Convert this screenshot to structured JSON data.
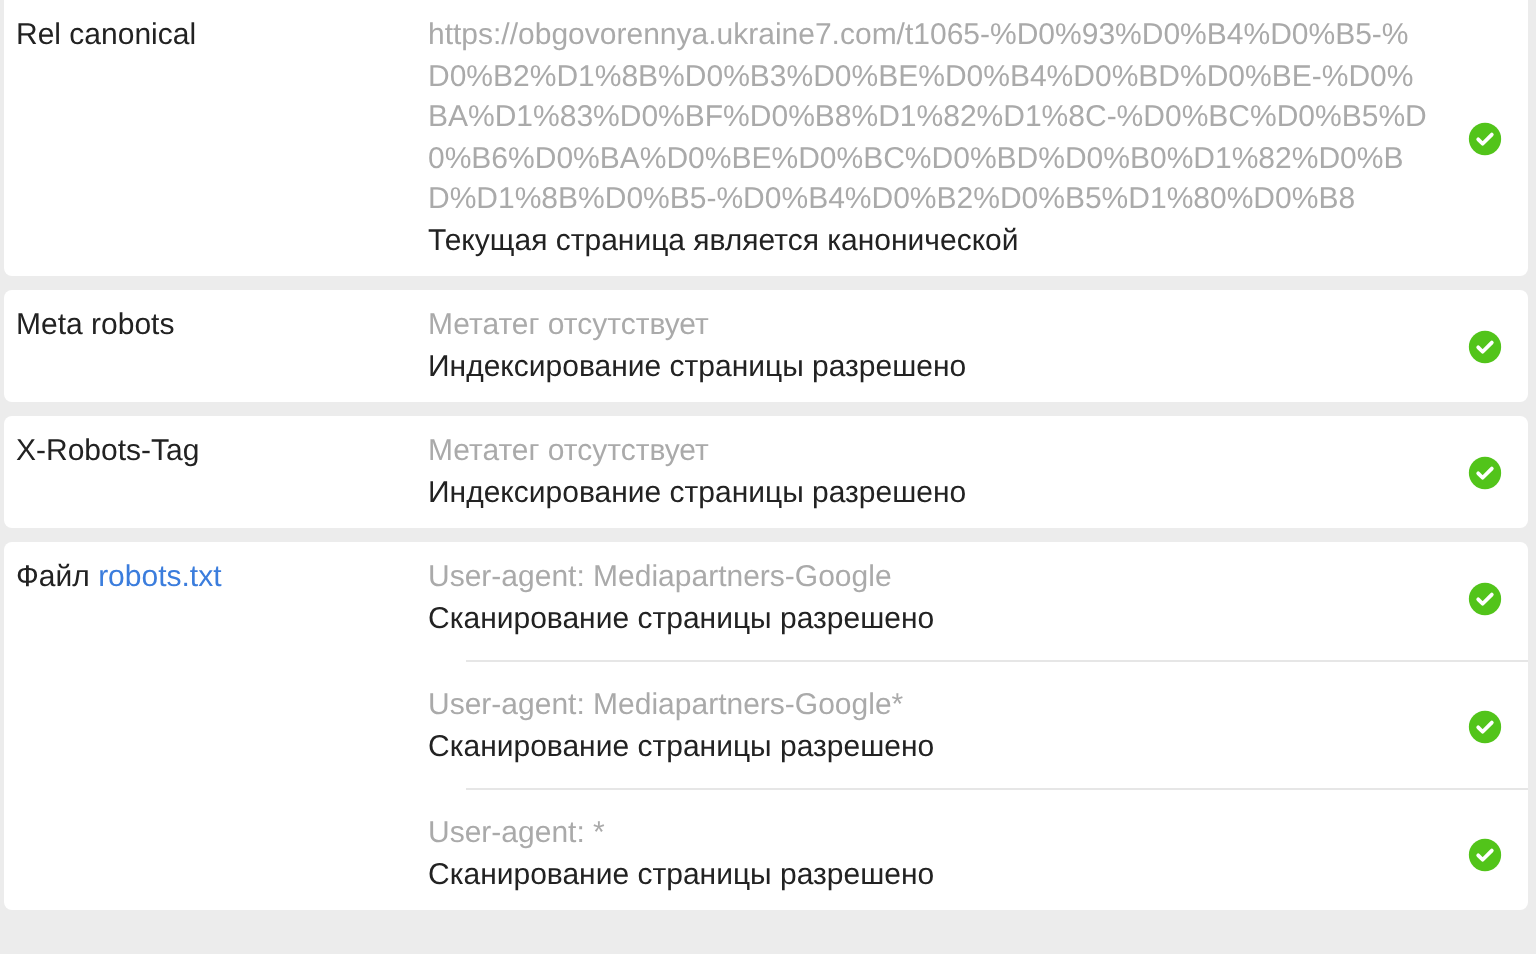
{
  "checks": [
    {
      "label": "Rel canonical",
      "entries": [
        {
          "detail": "https://obgovorennya.ukraine7.com/t1065-%D0%93%D0%B4%D0%B5-%D0%B2%D1%8B%D0%B3%D0%BE%D0%B4%D0%BD%D0%BE-%D0%BA%D1%83%D0%BF%D0%B8%D1%82%D1%8C-%D0%BC%D0%B5%D0%B6%D0%BA%D0%BE%D0%BC%D0%BD%D0%B0%D1%82%D0%BD%D1%8B%D0%B5-%D0%B4%D0%B2%D0%B5%D1%80%D0%B8",
          "result": "Текущая страница является канонической",
          "passed": true
        }
      ]
    },
    {
      "label": "Meta robots",
      "entries": [
        {
          "detail": "Метатег отсутствует",
          "result": "Индексирование страницы разрешено",
          "passed": true
        }
      ]
    },
    {
      "label": "X-Robots-Tag",
      "entries": [
        {
          "detail": "Метатег отсутствует",
          "result": "Индексирование страницы разрешено",
          "passed": true
        }
      ]
    },
    {
      "label": "Файл",
      "label_link": "robots.txt",
      "entries": [
        {
          "detail": "User-agent: Mediapartners-Google",
          "result": "Сканирование страницы разрешено",
          "passed": true
        },
        {
          "detail": "User-agent: Mediapartners-Google*",
          "result": "Сканирование страницы разрешено",
          "passed": true
        },
        {
          "detail": "User-agent: *",
          "result": "Сканирование страницы разрешено",
          "passed": true
        }
      ]
    }
  ]
}
